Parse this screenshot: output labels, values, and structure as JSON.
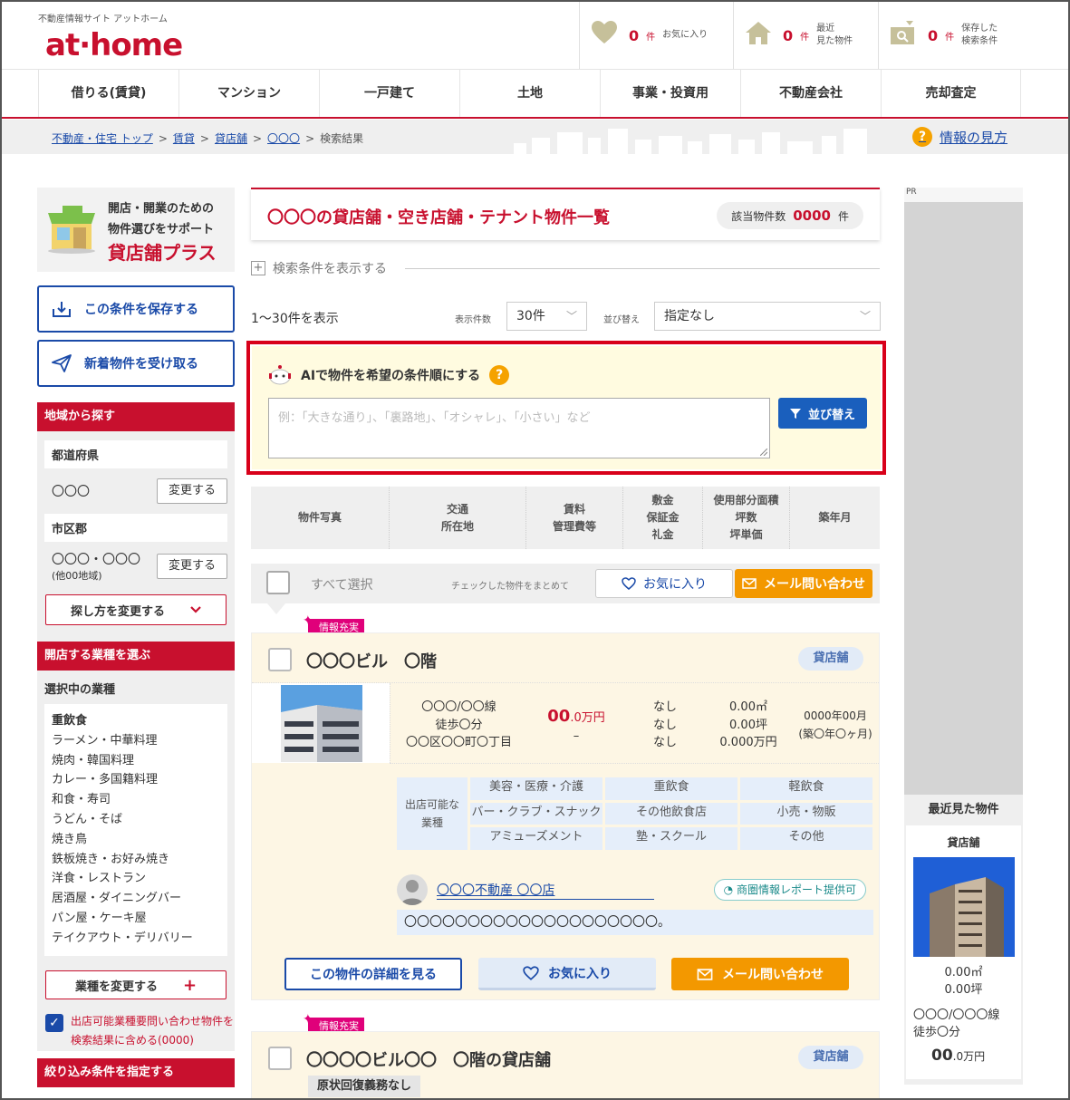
{
  "header": {
    "site_name": "不動産情報サイト アットホーム",
    "logo": "at·home",
    "counters": [
      {
        "icon": "heart-icon",
        "count": "0",
        "unit": "件",
        "label": "お気に入り"
      },
      {
        "icon": "house-icon",
        "count": "0",
        "unit": "件",
        "label": "最近\n見た物件"
      },
      {
        "icon": "saved-search-icon",
        "count": "0",
        "unit": "件",
        "label": "保存した\n検索条件"
      }
    ]
  },
  "nav": [
    "借りる(賃貸)",
    "マンション",
    "一戸建て",
    "土地",
    "事業・投資用",
    "不動産会社",
    "売却査定"
  ],
  "breadcrumb": {
    "items": [
      "不動産・住宅 トップ",
      "賃貸",
      "貸店舗",
      "〇〇〇"
    ],
    "current": "検索結果",
    "sep": ">",
    "help": "情報の見方"
  },
  "sidebar": {
    "promo_line1": "開店・開業のための",
    "promo_line2": "物件選びをサポート",
    "promo_title": "貸店舗プラス",
    "save_button": "この条件を保存する",
    "notify_button": "新着物件を受け取る",
    "area_head": "地域から探す",
    "pref_label": "都道府県",
    "pref_value": "〇〇〇",
    "change": "変更する",
    "city_label": "市区郡",
    "city_value": "〇〇〇・〇〇〇",
    "city_sub": "(他00地域)",
    "change_method": "探し方を変更する",
    "gyo_head": "開店する業種を選ぶ",
    "gyo_selected": "選択中の業種",
    "gyo_list": [
      "重飲食",
      "ラーメン・中華料理",
      "焼肉・韓国料理",
      "カレー・多国籍料理",
      "和食・寿司",
      "うどん・そば",
      "焼き鳥",
      "鉄板焼き・お好み焼き",
      "洋食・レストラン",
      "居酒屋・ダイニングバー",
      "パン屋・ケーキ屋",
      "テイクアウト・デリバリー"
    ],
    "gyo_change": "業種を変更する",
    "include_text": "出店可能業種要問い合わせ物件を検索結果に含める(0000)",
    "filter_head": "絞り込み条件を指定する"
  },
  "main": {
    "title": "〇〇〇の貸店舗・空き店舗・テナント物件一覧",
    "hit_label": "該当物件数",
    "hit_count": "0000",
    "hit_unit": "件",
    "show_conditions": "検索条件を表示する",
    "count_text": "1〜30件を表示",
    "per_page_label": "表示件数",
    "per_page_value": "30件",
    "sort_label": "並び替え",
    "sort_value": "指定なし"
  },
  "ai": {
    "title": "AIで物件を希望の条件順にする",
    "placeholder": "例：「大きな通り」、「裏路地」、「オシャレ」、「小さい」など",
    "button": "並び替え"
  },
  "table_header": [
    "物件写真",
    "交通\n所在地",
    "賃料\n管理費等",
    "敷金\n保証金\n礼金",
    "使用部分面積\n坪数\n坪単価",
    "築年月"
  ],
  "select_all": {
    "label": "すべて選択",
    "note": "チェックした物件をまとめて",
    "fav": "お気に入り",
    "mail": "メール問い合わせ"
  },
  "property1": {
    "badge": "情報充実",
    "name": "〇〇〇ビル　〇階",
    "type": "貸店舗",
    "access": "〇〇〇/〇〇線\n徒歩〇分\n〇〇区〇〇町〇丁目",
    "rent_main": "00",
    "rent_decimal": ".0万円",
    "rent_mgmt": "–",
    "deposits": "なし\nなし\nなし",
    "area": "0.00㎡\n0.00坪\n0.000万円",
    "built": "0000年00月\n(築〇年〇ヶ月)",
    "gyo_header": "出店可能な\n業種",
    "gyo_items": [
      "美容・医療・介護",
      "重飲食",
      "軽飲食",
      "バー・クラブ・スナック",
      "その他飲食店",
      "小売・物販",
      "アミューズメント",
      "塾・スクール",
      "その他"
    ],
    "agent": "〇〇〇不動産 〇〇店",
    "report": "商圏情報レポート提供可",
    "comment": "〇〇〇〇〇〇〇〇〇〇〇〇〇〇〇〇〇〇〇〇。",
    "detail_button": "この物件の詳細を見る",
    "fav_button": "お気に入り",
    "mail_button": "メール問い合わせ"
  },
  "property2": {
    "badge": "情報充実",
    "name": "〇〇〇〇ビル〇〇　〇階の貸店舗",
    "type": "貸店舗",
    "tag": "原状回復義務なし"
  },
  "right": {
    "pr": "PR",
    "recent_head": "最近見た物件",
    "recent_type": "貸店舗",
    "recent_area": "0.00㎡\n0.00坪",
    "recent_access": "〇〇〇/〇〇〇線\n徒歩〇分",
    "recent_rent_main": "00",
    "recent_rent_unit": ".0万円"
  },
  "colors": {
    "brand": "#c8102e",
    "link": "#1a4aa8",
    "orange": "#f39800",
    "ai_border": "#d8001a"
  }
}
